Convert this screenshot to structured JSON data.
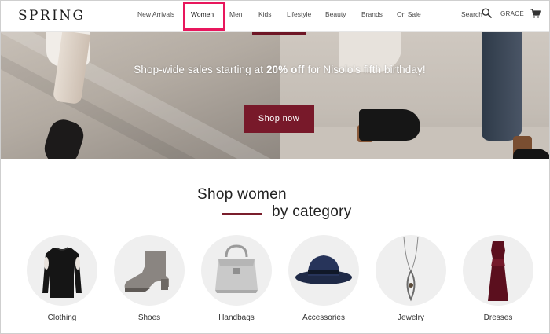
{
  "brand": {
    "logo": "SPRING"
  },
  "nav": {
    "items": [
      {
        "label": "New Arrivals",
        "active": false
      },
      {
        "label": "Women",
        "active": true
      },
      {
        "label": "Men",
        "active": false
      },
      {
        "label": "Kids",
        "active": false
      },
      {
        "label": "Lifestyle",
        "active": false
      },
      {
        "label": "Beauty",
        "active": false
      },
      {
        "label": "Brands",
        "active": false
      },
      {
        "label": "On Sale",
        "active": false
      }
    ]
  },
  "header": {
    "search_label": "Search",
    "search_icon": "magnifier",
    "account_label": "GRACE",
    "cart_icon": "shopping-cart"
  },
  "hero": {
    "promo_before": "Shop-wide sales starting at ",
    "promo_bold": "20% off",
    "promo_after": " for Nisolo's fifth birthday!",
    "cta_label": "Shop now"
  },
  "section": {
    "title_line1": "Shop women",
    "title_line2": "by category"
  },
  "categories": [
    {
      "label": "Clothing",
      "icon": "sweater"
    },
    {
      "label": "Shoes",
      "icon": "ankle-boot"
    },
    {
      "label": "Handbags",
      "icon": "handbag"
    },
    {
      "label": "Accessories",
      "icon": "hat"
    },
    {
      "label": "Jewelry",
      "icon": "necklace"
    },
    {
      "label": "Dresses",
      "icon": "dress"
    }
  ],
  "colors": {
    "accent": "#78192a",
    "highlight": "#e8175d",
    "rule": "#7a1e2c"
  }
}
